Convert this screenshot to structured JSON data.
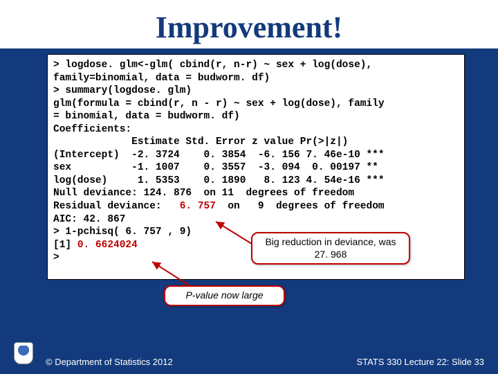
{
  "title": "Improvement!",
  "code": {
    "line1": "> logdose. glm<-glm( cbind(r, n-r) ~ sex + log(dose),",
    "line2": "family=binomial, data = budworm. df)",
    "line3": "> summary(logdose. glm)",
    "line4": "glm(formula = cbind(r, n - r) ~ sex + log(dose), family",
    "line5": "= binomial, data = budworm. df)",
    "line6": "Coefficients:",
    "line7": "             Estimate Std. Error z value Pr(>|z|)",
    "line8": "(Intercept)  -2. 3724    0. 3854  -6. 156 7. 46e-10 ***",
    "line9": "sex          -1. 1007    0. 3557  -3. 094  0. 00197 **",
    "line10": "log(dose)     1. 5353    0. 1890   8. 123 4. 54e-16 ***",
    "line11": "Null deviance: 124. 876  on 11  degrees of freedom",
    "line12a": "Residual deviance:   ",
    "line12b": "6. 757",
    "line12c": "  on   9  degrees of freedom",
    "line13": "AIC: 42. 867",
    "line14": "> 1-pchisq( 6. 757 , 9)",
    "line15": "[1] ",
    "line15b": "0. 6624024",
    "line16": ">"
  },
  "callouts": {
    "deviance": "Big reduction in deviance, was 27. 968",
    "pvalue": "P-value now large"
  },
  "footer": {
    "left": "© Department of Statistics 2012",
    "right": "STATS 330 Lecture 22: Slide 33"
  }
}
